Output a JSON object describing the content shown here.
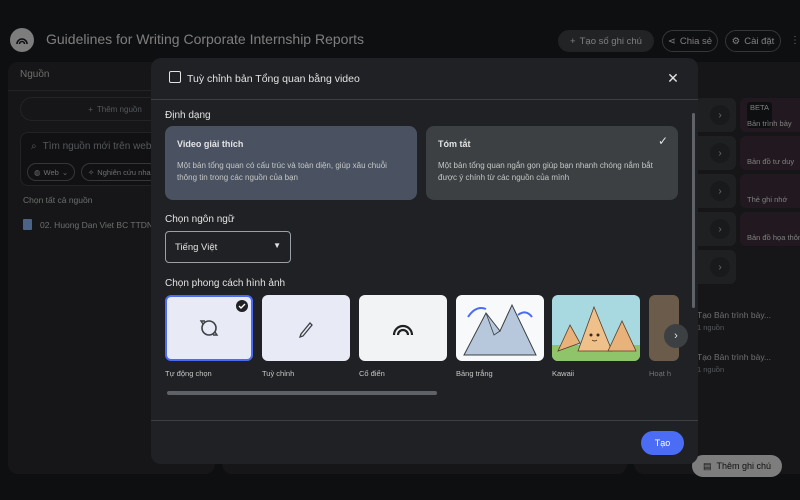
{
  "app": {
    "title": "Guidelines for Writing Corporate Internship Reports",
    "new_note_label": "Tạo số ghi chú",
    "share_label": "Chia sẻ",
    "settings_label": "Cài đặt"
  },
  "sources": {
    "title": "Nguồn",
    "add_label": "Thêm nguồn",
    "search_placeholder": "Tìm nguồn mới trên web",
    "chips": [
      "Web",
      "Nghiên cứu nha"
    ],
    "select_all_label": "Chọn tất cả nguồn",
    "items": [
      {
        "name": "02. Huong Dan Viet BC TTDN"
      }
    ]
  },
  "studio": {
    "tiles": [
      {
        "label": "Bản trình bày",
        "badge": "BETA"
      },
      {
        "label": "Bản đồ tư duy"
      },
      {
        "label": "Thẻ ghi nhớ"
      },
      {
        "label": "Bản đồ họa thôn"
      }
    ],
    "notes": [
      {
        "title": "Tạo Bản trình bày...",
        "sub": "1 nguồn"
      },
      {
        "title": "Tạo Bản trình bày...",
        "sub": "1 nguồn"
      }
    ],
    "add_note_label": "Thêm ghi chú"
  },
  "modal": {
    "title": "Tuỳ chỉnh bản Tổng quan bằng video",
    "format_label": "Định dạng",
    "formats": [
      {
        "title": "Video giải thích",
        "description": "Một bản tổng quan có cấu trúc và toàn diện, giúp xâu chuỗi thông tin trong các nguồn của bạn"
      },
      {
        "title": "Tóm tắt",
        "description": "Một bản tổng quan ngắn gọn giúp bạn nhanh chóng nắm bắt được ý chính từ các nguồn của mình"
      }
    ],
    "language_label": "Chọn ngôn ngữ",
    "language_value": "Tiếng Việt",
    "style_label": "Chọn phong cách hình ảnh",
    "styles": [
      {
        "label": "Tự động chọn"
      },
      {
        "label": "Tuỳ chỉnh"
      },
      {
        "label": "Cổ điển"
      },
      {
        "label": "Bảng trắng"
      },
      {
        "label": "Kawaii"
      },
      {
        "label": "Hoạt h"
      }
    ],
    "create_label": "Tạo"
  },
  "colors": {
    "accent": "#4b6cf5",
    "background": "#1b1c1f",
    "panel": "#28292c"
  }
}
